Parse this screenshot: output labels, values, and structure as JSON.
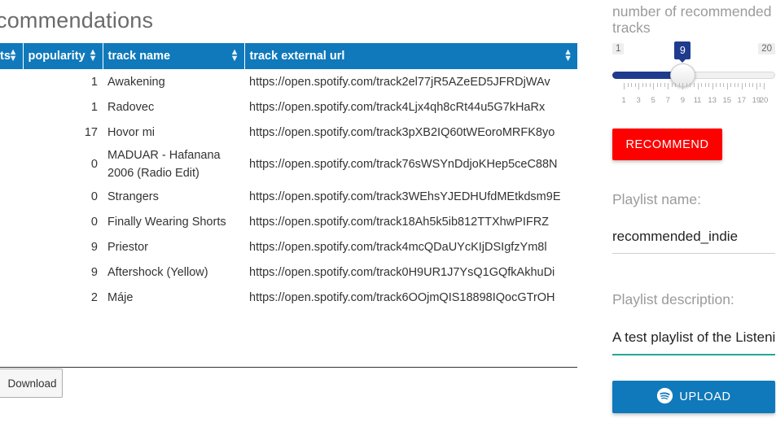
{
  "page": {
    "heading": "commendations"
  },
  "table": {
    "headers": [
      "ts",
      "popularity",
      "track name",
      "track external url"
    ],
    "rows": [
      {
        "popularity": "1",
        "track_name": "Awakening",
        "url": "https://open.spotify.com/track2el77jR5AZeED5JFRDjWAv"
      },
      {
        "popularity": "1",
        "track_name": "Radovec",
        "url": "https://open.spotify.com/track4Ljx4qh8cRt44u5G7kHaRx"
      },
      {
        "popularity": "17",
        "track_name": "Hovor mi",
        "url": "https://open.spotify.com/track3pXB2IQ60tWEoroMRFK8yo"
      },
      {
        "popularity": "0",
        "track_name": "MADUAR - Hafanana 2006 (Radio Edit)",
        "url": "https://open.spotify.com/track76sWSYnDdjoKHep5ceC88N"
      },
      {
        "popularity": "0",
        "track_name": "Strangers",
        "url": "https://open.spotify.com/track3WEhsYJEDHUfdMEtkdsm9E"
      },
      {
        "popularity": "0",
        "track_name": "Finally Wearing Shorts",
        "url": "https://open.spotify.com/track18Ah5k5ib812TTXhwPIFRZ"
      },
      {
        "popularity": "9",
        "track_name": "Priestor",
        "url": "https://open.spotify.com/track4mcQDaUYcKIjDSIgfzYm8l"
      },
      {
        "popularity": "9",
        "track_name": "Aftershock (Yellow)",
        "url": "https://open.spotify.com/track0H9UR1J7YsQ1GQfkAkhuDi"
      },
      {
        "popularity": "2",
        "track_name": "Máje",
        "url": "https://open.spotify.com/track6OOjmQIS18898IQocGTrOH"
      }
    ]
  },
  "download_button": "Download",
  "slider": {
    "label": "number of recommended tracks",
    "min": "1",
    "max": "20",
    "value": "9",
    "tick_labels": [
      "1",
      "3",
      "5",
      "7",
      "9",
      "11",
      "13",
      "15",
      "17",
      "19",
      "20"
    ]
  },
  "recommend_button": "RECOMMEND",
  "playlist_name": {
    "label": "Playlist name:",
    "value": "recommended_indie"
  },
  "playlist_description": {
    "label": "Playlist description:",
    "value": "A test playlist of the Listening"
  },
  "upload_button": {
    "label": "UPLOAD",
    "icon": "spotify-icon"
  },
  "colors": {
    "header_blue": "#0f79bb",
    "slider_blue": "#1f3b8d",
    "recommend_red": "#ff0000",
    "focus_teal": "#26a69a"
  }
}
